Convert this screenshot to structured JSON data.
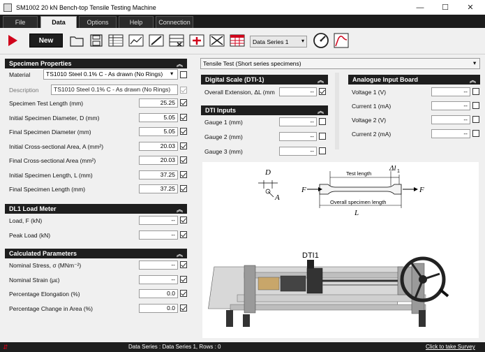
{
  "window": {
    "title": "SM1002 20 kN Bench-top Tensile Testing Machine",
    "minimize": "—",
    "maximize": "☐",
    "close": "✕"
  },
  "menu": {
    "tabs": [
      "File",
      "Data",
      "Options",
      "Help",
      "Connection"
    ]
  },
  "toolbar": {
    "new_label": "New",
    "series_select": "Data Series 1"
  },
  "test_type": "Tensile Test (Short series specimens)",
  "specimen": {
    "header": "Specimen Properties",
    "material_label": "Material",
    "material_value": "TS1010 Steel 0.1% C - As drawn (No Rings)",
    "description_label": "Description",
    "description_value": "TS1010 Steel 0.1% C - As drawn (No Rings)",
    "rows": [
      {
        "label": "Specimen Test Length (mm)",
        "value": "25.25"
      },
      {
        "label": "Initial Specimen Diameter, D (mm)",
        "value": "5.05"
      },
      {
        "label": "Final Specimen Diameter (mm)",
        "value": "5.05"
      },
      {
        "label": "Initial Cross-sectional Area, A (mm²)",
        "value": "20.03"
      },
      {
        "label": "Final Cross-sectional Area (mm²)",
        "value": "20.03"
      },
      {
        "label": "Initial Specimen Length, L (mm)",
        "value": "37.25"
      },
      {
        "label": "Final Specimen Length (mm)",
        "value": "37.25"
      }
    ]
  },
  "load": {
    "header": "DL1 Load Meter",
    "rows": [
      {
        "label": "Load, F (kN)",
        "value": "--"
      },
      {
        "label": "Peak Load (kN)",
        "value": "--"
      }
    ]
  },
  "calc": {
    "header": "Calculated Parameters",
    "rows": [
      {
        "label": "Nominal Stress, σ (MNm⁻²)",
        "value": "--"
      },
      {
        "label": "Nominal Strain (με)",
        "value": "--"
      },
      {
        "label": "Percentage Elongation (%)",
        "value": "0.0"
      },
      {
        "label": "Percentage Change in Area (%)",
        "value": "0.0"
      }
    ]
  },
  "digital": {
    "header": "Digital Scale (DTI-1)",
    "label": "Overall Extension, ΔL (mm",
    "value": "--"
  },
  "dti": {
    "header": "DTI Inputs",
    "rows": [
      {
        "label": "Gauge 1 (mm)",
        "value": "--"
      },
      {
        "label": "Gauge 2 (mm)",
        "value": "--"
      },
      {
        "label": "Gauge 3 (mm)",
        "value": "--"
      }
    ]
  },
  "analogue": {
    "header": "Analogue Input Board",
    "rows": [
      {
        "label": "Voltage 1 (V)",
        "value": "--"
      },
      {
        "label": "Current 1 (mA)",
        "value": "--"
      },
      {
        "label": "Voltage 2 (V)",
        "value": "--"
      },
      {
        "label": "Current 2 (mA)",
        "value": "--"
      }
    ]
  },
  "diagram": {
    "d_label": "D",
    "a_label": "A",
    "test_length": "Test length",
    "delta": "Δl",
    "delta_sub": "1",
    "f_left": "F",
    "f_right": "F",
    "overall": "Overall specimen length",
    "l_label": "L",
    "dti_label": "DTI1"
  },
  "status": {
    "text": "Data Series : Data Series 1,  Rows : 0",
    "link": "Click to take Survey"
  },
  "colors": {
    "accent_red": "#d0021b",
    "header_bg": "#1e1e1e",
    "status_bg": "#1e1e1e"
  }
}
